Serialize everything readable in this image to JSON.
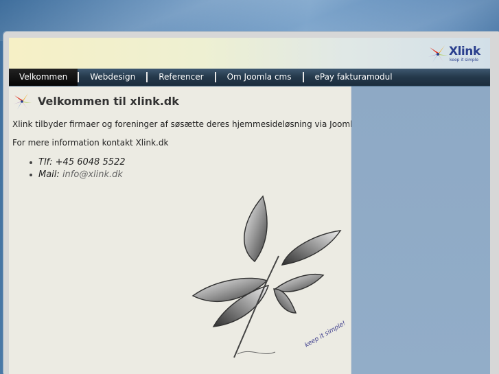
{
  "header": {
    "logo_text": "Xlink",
    "logo_tagline": "keep it simple"
  },
  "nav": {
    "items": [
      {
        "label": "Velkommen",
        "active": true
      },
      {
        "label": "Webdesign",
        "active": false
      },
      {
        "label": "Referencer",
        "active": false
      },
      {
        "label": "Om Joomla cms",
        "active": false
      },
      {
        "label": "ePay fakturamodul",
        "active": false
      }
    ]
  },
  "main": {
    "title": "Velkommen til xlink.dk",
    "intro": "Xlink tilbyder firmaer og foreninger af søsætte deres hjemmesideløsning via Joomla CMS.",
    "more_info": "For mere information kontakt Xlink.dk",
    "contact": {
      "phone_label": "Tlf:",
      "phone": "+45 6048 5522",
      "mail_label": "Mail:",
      "mail": "info@xlink.dk"
    },
    "illustration_caption": "keep it simple!"
  },
  "colors": {
    "nav_bg": "#24384a",
    "nav_active": "#0a0a0a",
    "content_bg": "#ecebe3",
    "sidebar_bg": "#8ea9c5",
    "logo_blue": "#2a3f8e"
  },
  "icons": {
    "logo": "xlink-star-logo",
    "title": "xlink-star-icon",
    "illustration": "butterfly-sketch"
  }
}
